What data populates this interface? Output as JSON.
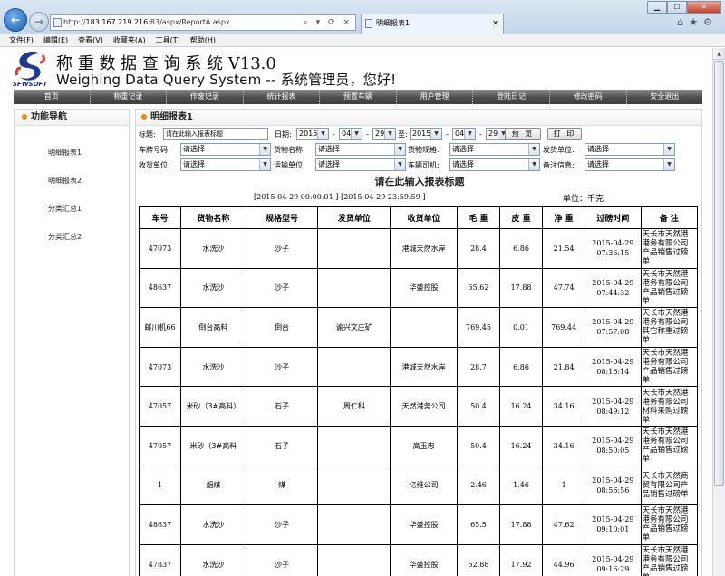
{
  "browser": {
    "url_prefix": "http://",
    "url_domain": "183.167.219.216",
    "url_rest": ":83/aspx/ReportA.aspx",
    "tab_title": "明细报表1",
    "search_ctrls": "⌕ ▾ ⟳ ×",
    "win_min": "▁",
    "win_max": "☐",
    "win_close": "✕",
    "tools": "⌂★⚙"
  },
  "menubar": [
    "文件(F)",
    "编辑(E)",
    "查看(V)",
    "收藏夹(A)",
    "工具(T)",
    "帮助(H)"
  ],
  "header": {
    "logo_text": "SFWSOFT",
    "title_cn": "称 重 数 据 查 询 系 统 V13.0",
    "title_en": "Weighing Data Query System -- 系统管理员，您好!"
  },
  "nav": [
    "首页",
    "称重记录",
    "作废记录",
    "统计报表",
    "预置车辆",
    "用户管理",
    "登陆日记",
    "修改密码",
    "安全退出"
  ],
  "sidebar": {
    "title": "功能导航",
    "items": [
      "明细报表1",
      "明细报表2",
      "分类汇总1",
      "分类汇总2"
    ]
  },
  "main": {
    "title": "明细报表1",
    "filters": {
      "title_label": "标题:",
      "title_value": "请在此输入报表标题",
      "date_label": "日期:",
      "from_year": "2015",
      "from_month": "04",
      "from_day": "29",
      "to_label": "至:",
      "to_year": "2015",
      "to_month": "04",
      "to_day": "29",
      "dash": "-",
      "preview_btn": "预 览",
      "print_btn": "打 印",
      "plate_label": "车牌号码:",
      "goods_label": "货物名称:",
      "spec_label": "货物规格:",
      "sender_label": "发货单位:",
      "receiver_label": "收货单位:",
      "carrier_label": "运输单位:",
      "driver_label": "车辆司机:",
      "note_label": "备注信息:",
      "select_placeholder": "请选择"
    },
    "report_title": "请在此输入报表标题",
    "period": "[2015-04-29 00:00:01 ]-[2015-04-29 23:59:59 ]",
    "unit": "单位：千克",
    "columns": [
      "车号",
      "货物名称",
      "规格型号",
      "发货单位",
      "收货单位",
      "毛 重",
      "皮 重",
      "净 重",
      "过磅时间",
      "备 注"
    ],
    "rows": [
      [
        "47073",
        "水洗沙",
        "沙子",
        "",
        "港城天然水岸",
        "28.4",
        "6.86",
        "21.54",
        "2015-04-29 07:36:15",
        "天长市天然港港务有限公司产品销售过磅单"
      ],
      [
        "48637",
        "水洗沙",
        "沙子",
        "",
        "华盛控股",
        "65.62",
        "17.88",
        "47.74",
        "2015-04-29 07:44:32",
        "天长市天然港港务有限公司产品销售过磅单"
      ],
      [
        "邮川机66",
        "倒台高料",
        "倒台",
        "谕兴文庄矿",
        "",
        "769.45",
        "0.01",
        "769.44",
        "2015-04-29 07:57:08",
        "天长市天然港港务有限公司其它称重过磅单"
      ],
      [
        "47073",
        "水洗沙",
        "沙子",
        "",
        "港城天然水岸",
        "28.7",
        "6.86",
        "21.84",
        "2015-04-29 08:16:14",
        "天长市天然港港务有限公司产品销售过磅单"
      ],
      [
        "47057",
        "米砂（3#高料）",
        "石子",
        "周仁科",
        "天然港务公司",
        "50.4",
        "16.24",
        "34.16",
        "2015-04-29 08:49:12",
        "天长市天然港港务有限公司材料采购过磅单"
      ],
      [
        "47057",
        "米砂（3#高料",
        "石子",
        "",
        "高玉忠",
        "50.4",
        "16.24",
        "34.16",
        "2015-04-29 08:50:05",
        "天长市天然港港务有限公司产品销售过磅单"
      ],
      [
        "1",
        "烟煤",
        "煤",
        "",
        "亿维公司",
        "2.46",
        "1.46",
        "1",
        "2015-04-29 08:56:56",
        "天长市天然商贸有限公司产品销售过磅单"
      ],
      [
        "48637",
        "水洗沙",
        "沙子",
        "",
        "华盛控股",
        "65.5",
        "17.88",
        "47.62",
        "2015-04-29 09:10:01",
        "天长市天然港港务有限公司产品销售过磅单"
      ],
      [
        "47837",
        "水洗沙",
        "沙子",
        "",
        "华盛控股",
        "62.88",
        "17.92",
        "44.96",
        "2015-04-29 09:16:29",
        "天长市天然港港务有限公司产品销售过磅单"
      ]
    ]
  }
}
